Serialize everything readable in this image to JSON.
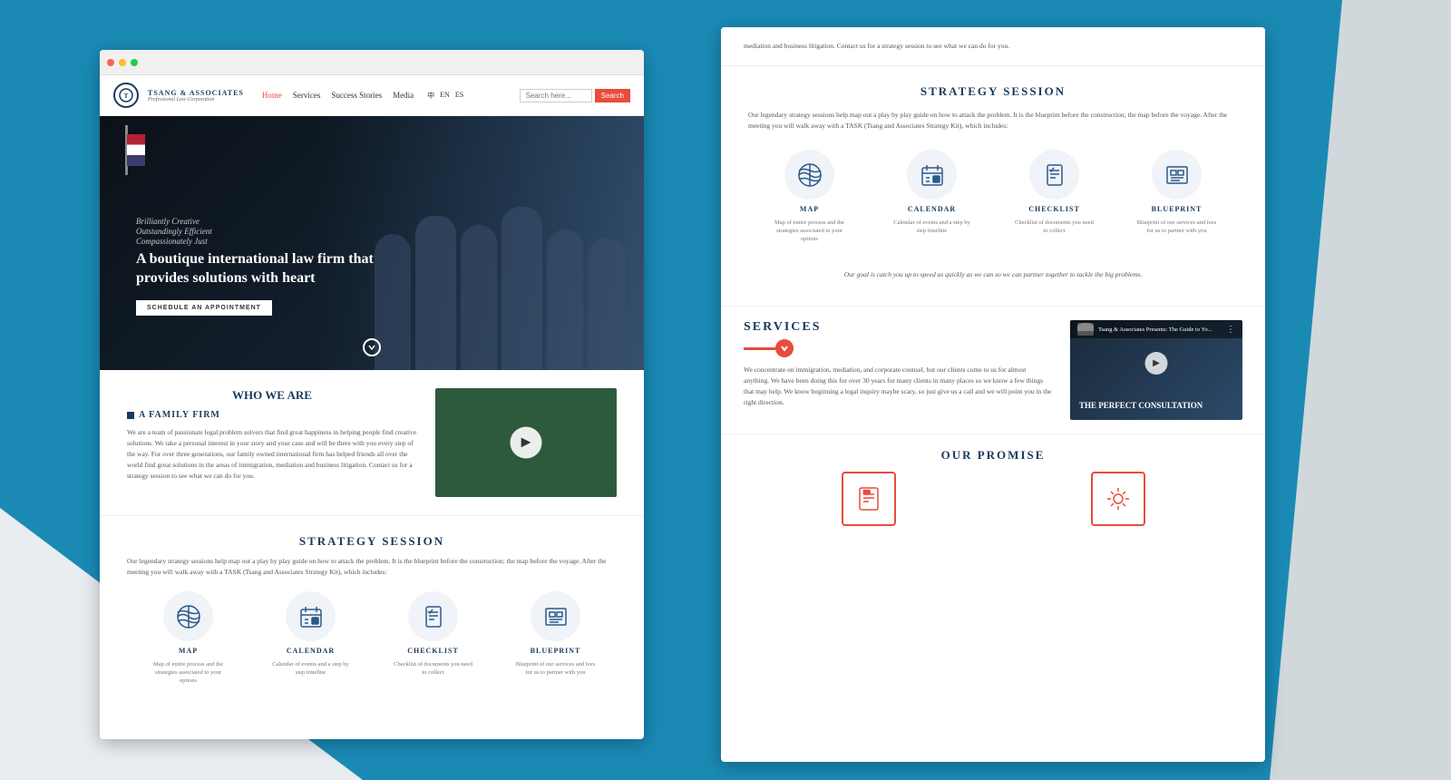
{
  "brand": {
    "name": "TSANG & ASSOCIATES",
    "tagline": "Professional Law Corporation",
    "logo_char": "T"
  },
  "nav": {
    "home_label": "Home",
    "services_label": "Services",
    "success_label": "Success Stories",
    "media_label": "Media",
    "lang_zh": "中",
    "lang_en": "EN",
    "lang_es": "ES",
    "search_placeholder": "Search here...",
    "search_btn": "Search"
  },
  "hero": {
    "tagline1": "Brilliantly Creative",
    "tagline2": "Outstandingly Efficient",
    "tagline3": "Compassionately Just",
    "title": "A boutique international law firm that provides solutions with heart",
    "cta": "SCHEDULE AN APPOINTMENT"
  },
  "who_we_are": {
    "title": "WHO WE ARE",
    "subtitle": "A FAMILY FIRM",
    "body": "We are a team of passionate legal problem solvers that find great happiness in helping people find creative solutions. We take a personal interest in your story and your case and will be there with you every step of the way. For over three generations, our family owned international firm has helped friends all over the world find great solutions in the areas of immigration, mediation and business litigation. Contact us for a strategy session to see what we can do for you."
  },
  "strategy": {
    "title": "STRATEGY SESSION",
    "body": "Our legendary strategy sessions help map out a play by play guide on how to attack the problem. It is the blueprint before the construction; the map before the voyage. After the meeting you will walk away with a TASK (Tsang and Associates Strategy Kit), which includes:",
    "icons": [
      {
        "label": "MAP",
        "desc": "Map of entire process and the strategies associated to your options"
      },
      {
        "label": "CALENDAR",
        "desc": "Calendar of events and a step by step timeline"
      },
      {
        "label": "CHECKLIST",
        "desc": "Checklist of documents you need to collect"
      },
      {
        "label": "BLUEPRINT",
        "desc": "Blueprint of our services and fees for us to partner with you"
      }
    ]
  },
  "goal_text": "Our goal is catch you up to speed as quickly as we can so we can partner together to tackle the big problems.",
  "services": {
    "title": "SERVICES",
    "body": "We concentrate on immigration, mediation, and corporate counsel, but our clients come to us for almost anything. We have been doing this for over 30 years for many clients in many places so we know a few things that may help. We know beginning a legal inquiry maybe scary, so just give us a call and we will point you in the right direction.",
    "video_title": "Tsang & Associates Presents: The Guide to Yo...",
    "video_overlay": "THE PERFECT CONSULTATION"
  },
  "promise": {
    "title": "OUR PROMISE"
  },
  "right_top_text": "mediation and business litigation. Contact us for a strategy session to see what we can do for you."
}
